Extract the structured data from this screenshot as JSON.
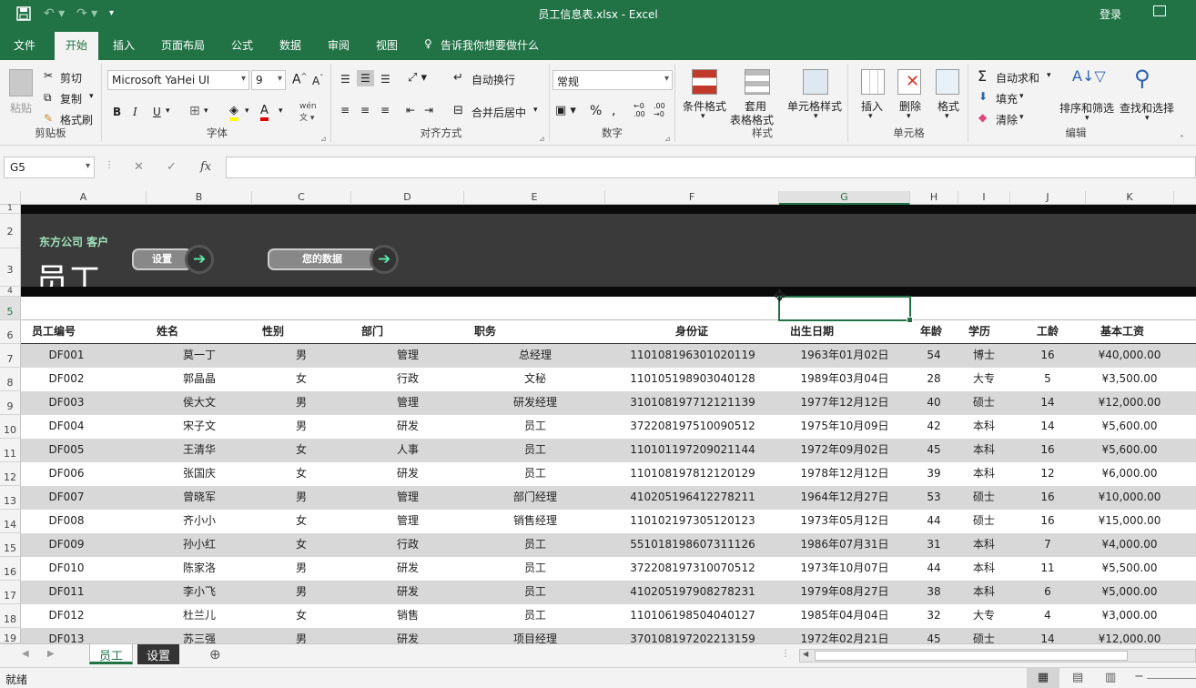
{
  "app": {
    "title": "员工信息表.xlsx  -  Excel",
    "login": "登录"
  },
  "tabs": [
    "文件",
    "开始",
    "插入",
    "页面布局",
    "公式",
    "数据",
    "审阅",
    "视图"
  ],
  "tell_me": "告诉我你想要做什么",
  "ribbon": {
    "clipboard": {
      "paste": "粘贴",
      "cut": "剪切",
      "copy": "复制",
      "format_painter": "格式刷",
      "label": "剪贴板"
    },
    "font": {
      "name": "Microsoft YaHei UI",
      "size": "9",
      "bold": "B",
      "italic": "I",
      "underline": "U",
      "label": "字体"
    },
    "align": {
      "wrap": "自动换行",
      "merge": "合并后居中",
      "label": "对齐方式"
    },
    "number": {
      "format": "常规",
      "label": "数字"
    },
    "styles": {
      "cond": "条件格式",
      "table1": "套用",
      "table2": "表格格式",
      "cell": "单元格样式",
      "label": "样式"
    },
    "cells": {
      "insert": "插入",
      "delete": "删除",
      "format": "格式",
      "label": "单元格"
    },
    "editing": {
      "autosum": "自动求和",
      "fill": "填充",
      "clear": "清除",
      "sort": "排序和筛选",
      "find": "查找和选择",
      "label": "编辑"
    }
  },
  "formula_bar": {
    "name_box": "G5",
    "value": ""
  },
  "columns": [
    "A",
    "B",
    "C",
    "D",
    "E",
    "F",
    "G",
    "H",
    "I",
    "J",
    "K"
  ],
  "rows": [
    "1",
    "2",
    "3",
    "4",
    "5",
    "6",
    "7",
    "8",
    "9",
    "10",
    "11",
    "12",
    "13",
    "14",
    "15",
    "16",
    "17",
    "18",
    "19"
  ],
  "banner": {
    "subtitle": "东方公司 客户",
    "title": "员工",
    "btn_settings": "设置",
    "btn_data": "您的数据"
  },
  "table": {
    "headers": [
      "员工编号",
      "姓名",
      "性别",
      "部门",
      "职务",
      "身份证",
      "出生日期",
      "年龄",
      "学历",
      "工龄",
      "基本工资"
    ],
    "rows": [
      [
        "DF001",
        "莫一丁",
        "男",
        "管理",
        "总经理",
        "110108196301020119",
        "1963年01月02日",
        "54",
        "博士",
        "16",
        "¥40,000.00"
      ],
      [
        "DF002",
        "郭晶晶",
        "女",
        "行政",
        "文秘",
        "110105198903040128",
        "1989年03月04日",
        "28",
        "大专",
        "5",
        "¥3,500.00"
      ],
      [
        "DF003",
        "侯大文",
        "男",
        "管理",
        "研发经理",
        "310108197712121139",
        "1977年12月12日",
        "40",
        "硕士",
        "14",
        "¥12,000.00"
      ],
      [
        "DF004",
        "宋子文",
        "男",
        "研发",
        "员工",
        "372208197510090512",
        "1975年10月09日",
        "42",
        "本科",
        "14",
        "¥5,600.00"
      ],
      [
        "DF005",
        "王清华",
        "女",
        "人事",
        "员工",
        "110101197209021144",
        "1972年09月02日",
        "45",
        "本科",
        "16",
        "¥5,600.00"
      ],
      [
        "DF006",
        "张国庆",
        "女",
        "研发",
        "员工",
        "110108197812120129",
        "1978年12月12日",
        "39",
        "本科",
        "12",
        "¥6,000.00"
      ],
      [
        "DF007",
        "曾晓军",
        "男",
        "管理",
        "部门经理",
        "410205196412278211",
        "1964年12月27日",
        "53",
        "硕士",
        "16",
        "¥10,000.00"
      ],
      [
        "DF008",
        "齐小小",
        "女",
        "管理",
        "销售经理",
        "110102197305120123",
        "1973年05月12日",
        "44",
        "硕士",
        "16",
        "¥15,000.00"
      ],
      [
        "DF009",
        "孙小红",
        "女",
        "行政",
        "员工",
        "551018198607311126",
        "1986年07月31日",
        "31",
        "本科",
        "7",
        "¥4,000.00"
      ],
      [
        "DF010",
        "陈家洛",
        "男",
        "研发",
        "员工",
        "372208197310070512",
        "1973年10月07日",
        "44",
        "本科",
        "11",
        "¥5,500.00"
      ],
      [
        "DF011",
        "李小飞",
        "男",
        "研发",
        "员工",
        "410205197908278231",
        "1979年08月27日",
        "38",
        "本科",
        "6",
        "¥5,000.00"
      ],
      [
        "DF012",
        "杜兰儿",
        "女",
        "销售",
        "员工",
        "110106198504040127",
        "1985年04月04日",
        "32",
        "大专",
        "4",
        "¥3,000.00"
      ],
      [
        "DF013",
        "苏三强",
        "男",
        "研发",
        "项目经理",
        "370108197202213159",
        "1972年02月21日",
        "45",
        "硕士",
        "14",
        "¥12,000.00"
      ]
    ]
  },
  "sheets": [
    "员工",
    "设置"
  ],
  "status": "就绪"
}
